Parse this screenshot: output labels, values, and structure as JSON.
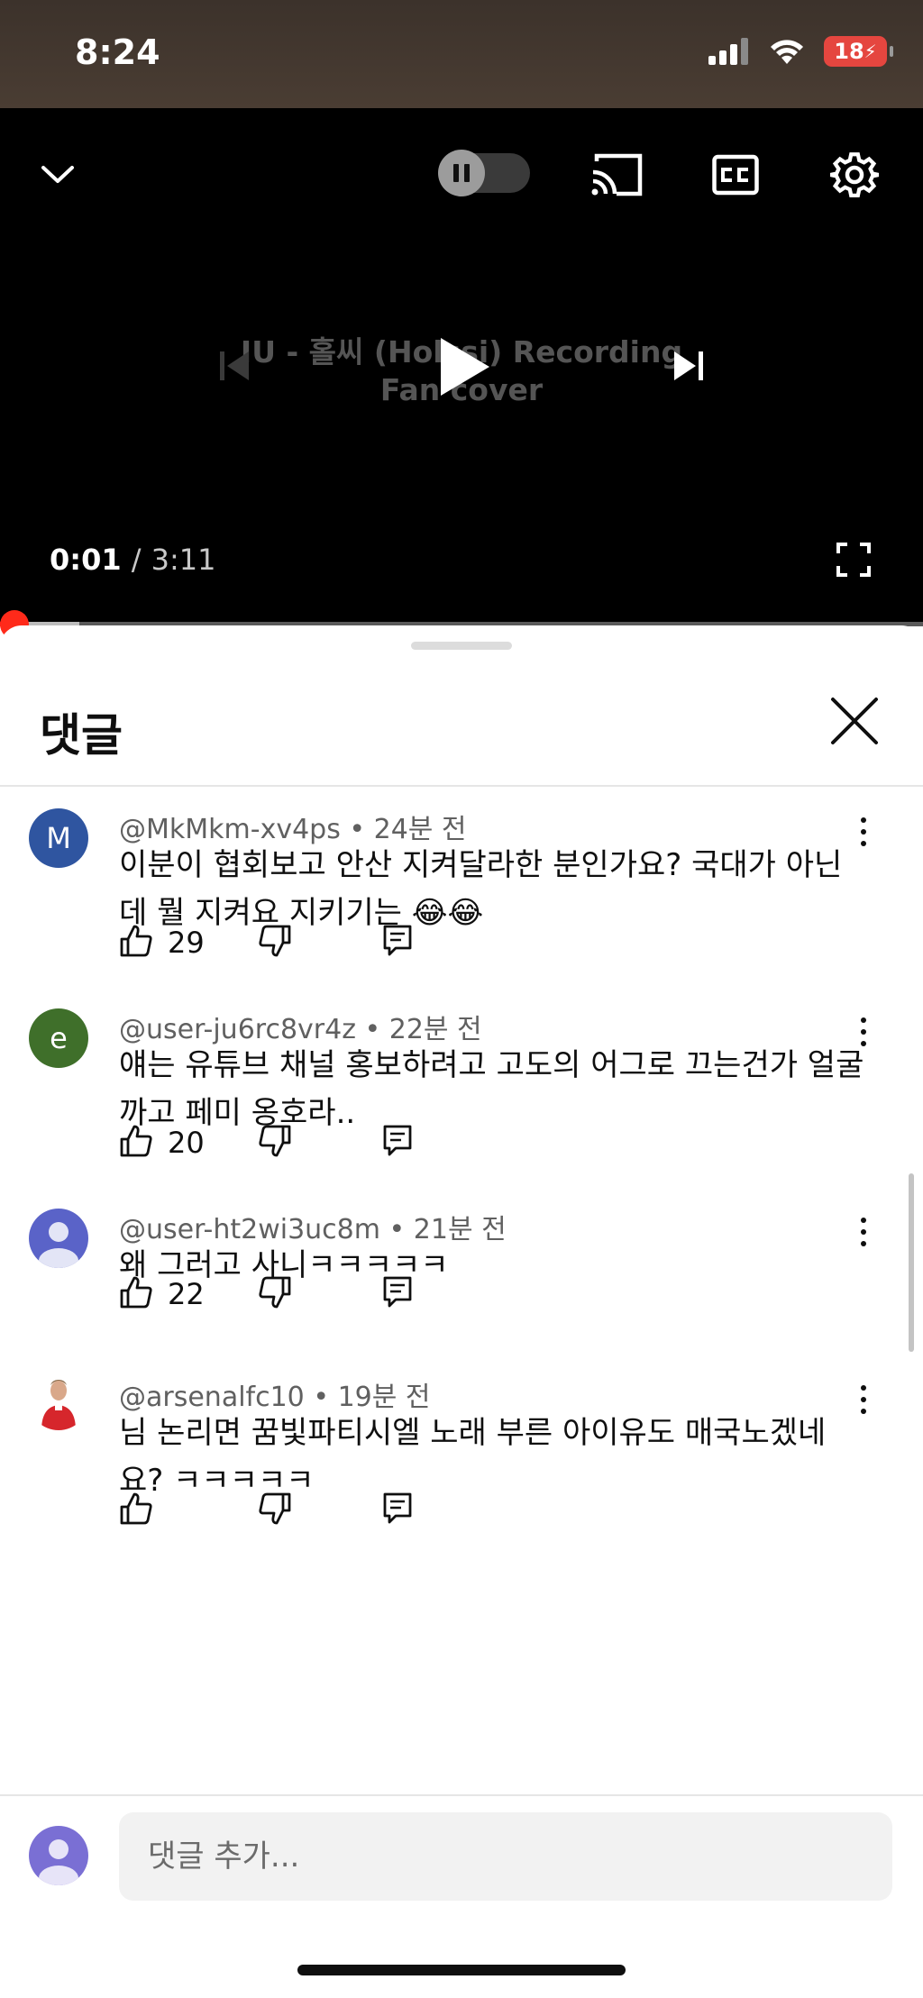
{
  "status_bar": {
    "time": "8:24",
    "battery": "18"
  },
  "player": {
    "title_line1": "IU - 홀씨 (Holssi) Recording",
    "title_line2": "Fan cover",
    "current_time": "0:01",
    "separator": "/",
    "duration": "3:11",
    "progress_fraction": 0.005,
    "icons": [
      "chevron-down-icon",
      "autoplay-toggle",
      "cast-icon",
      "cc-icon",
      "settings-icon",
      "previous-icon",
      "play-icon",
      "next-icon",
      "fullscreen-icon"
    ]
  },
  "comments_panel": {
    "title": "댓글",
    "comments": [
      {
        "handle": "@MkMkm-xv4ps",
        "time": "24분 전",
        "text": "이분이 협회보고 안산 지켜달라한 분인가요? 국대가 아닌데 뭘 지켜요 지키기는 😂😂",
        "likes": "29",
        "avatar_letter": "M",
        "avatar_color": "#2f55a0"
      },
      {
        "handle": "@user-ju6rc8vr4z",
        "time": "22분 전",
        "text": "얘는 유튜브 채널 홍보하려고 고도의 어그로 끄는건가 얼굴까고 페미 옹호라..",
        "likes": "20",
        "avatar_letter": "e",
        "avatar_color": "#3f6f2a"
      },
      {
        "handle": "@user-ht2wi3uc8m",
        "time": "21분 전",
        "text": "왜 그러고 사니ㅋㅋㅋㅋㅋ",
        "likes": "22",
        "avatar_letter": "",
        "avatar_color": "#5a63c8"
      },
      {
        "handle": "@arsenalfc10",
        "time": "19분 전",
        "text": "님 논리면 꿈빛파티시엘 노래 부른 아이유도 매국노겠네요? ㅋㅋㅋㅋㅋ",
        "likes": "",
        "avatar_letter": "",
        "avatar_color": "#ffffff"
      }
    ]
  },
  "comment_input": {
    "placeholder": "댓글 추가..."
  }
}
